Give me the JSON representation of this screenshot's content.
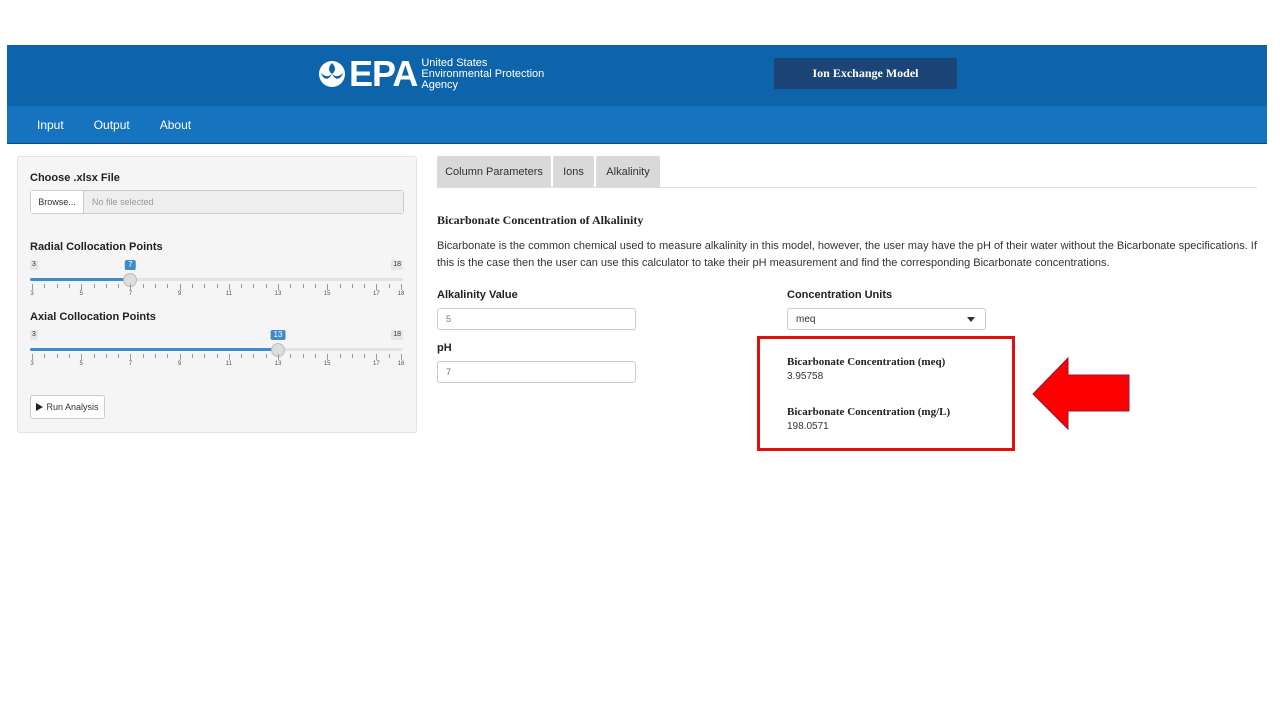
{
  "header": {
    "logo_word": "EPA",
    "logo_lines": [
      "United States",
      "Environmental Protection",
      "Agency"
    ],
    "app_title": "Ion Exchange Model",
    "brand_color": "#0e64aa"
  },
  "nav": {
    "items": [
      "Input",
      "Output",
      "About"
    ]
  },
  "sidebar": {
    "file_label": "Choose .xlsx File",
    "browse_label": "Browse...",
    "file_placeholder": "No file selected",
    "radial": {
      "label": "Radial Collocation Points",
      "min": 3,
      "max": 18,
      "value": 7,
      "ticks": [
        "3",
        "5",
        "7",
        "9",
        "11",
        "13",
        "15",
        "17",
        "18"
      ]
    },
    "axial": {
      "label": "Axial Collocation Points",
      "min": 3,
      "max": 18,
      "value": 13,
      "ticks": [
        "3",
        "5",
        "7",
        "9",
        "11",
        "13",
        "15",
        "17",
        "18"
      ]
    },
    "run_label": "Run Analysis",
    "run_icon": "play-icon"
  },
  "tabs": [
    "Column Parameters",
    "Ions",
    "Alkalinity"
  ],
  "main": {
    "section_title": "Bicarbonate Concentration of Alkalinity",
    "description": "Bicarbonate is the common chemical used to measure alkalinity in this model, however, the user may have the pH of their water without the Bicarbonate specifications. If this is the case then the user can use this calculator to take their pH measurement and find the corresponding Bicarbonate concentrations.",
    "alkalinity_label": "Alkalinity Value",
    "alkalinity_value": "5",
    "ph_label": "pH",
    "ph_value": "7",
    "units_label": "Concentration Units",
    "units_value": "meq",
    "result_meq_label": "Bicarbonate Concentration (meq)",
    "result_meq_value": "3.95758",
    "result_mgl_label": "Bicarbonate Concentration (mg/L)",
    "result_mgl_value": "198.0571"
  },
  "annotation": {
    "color": "#e01010",
    "arrow_color": "#ff0000"
  }
}
